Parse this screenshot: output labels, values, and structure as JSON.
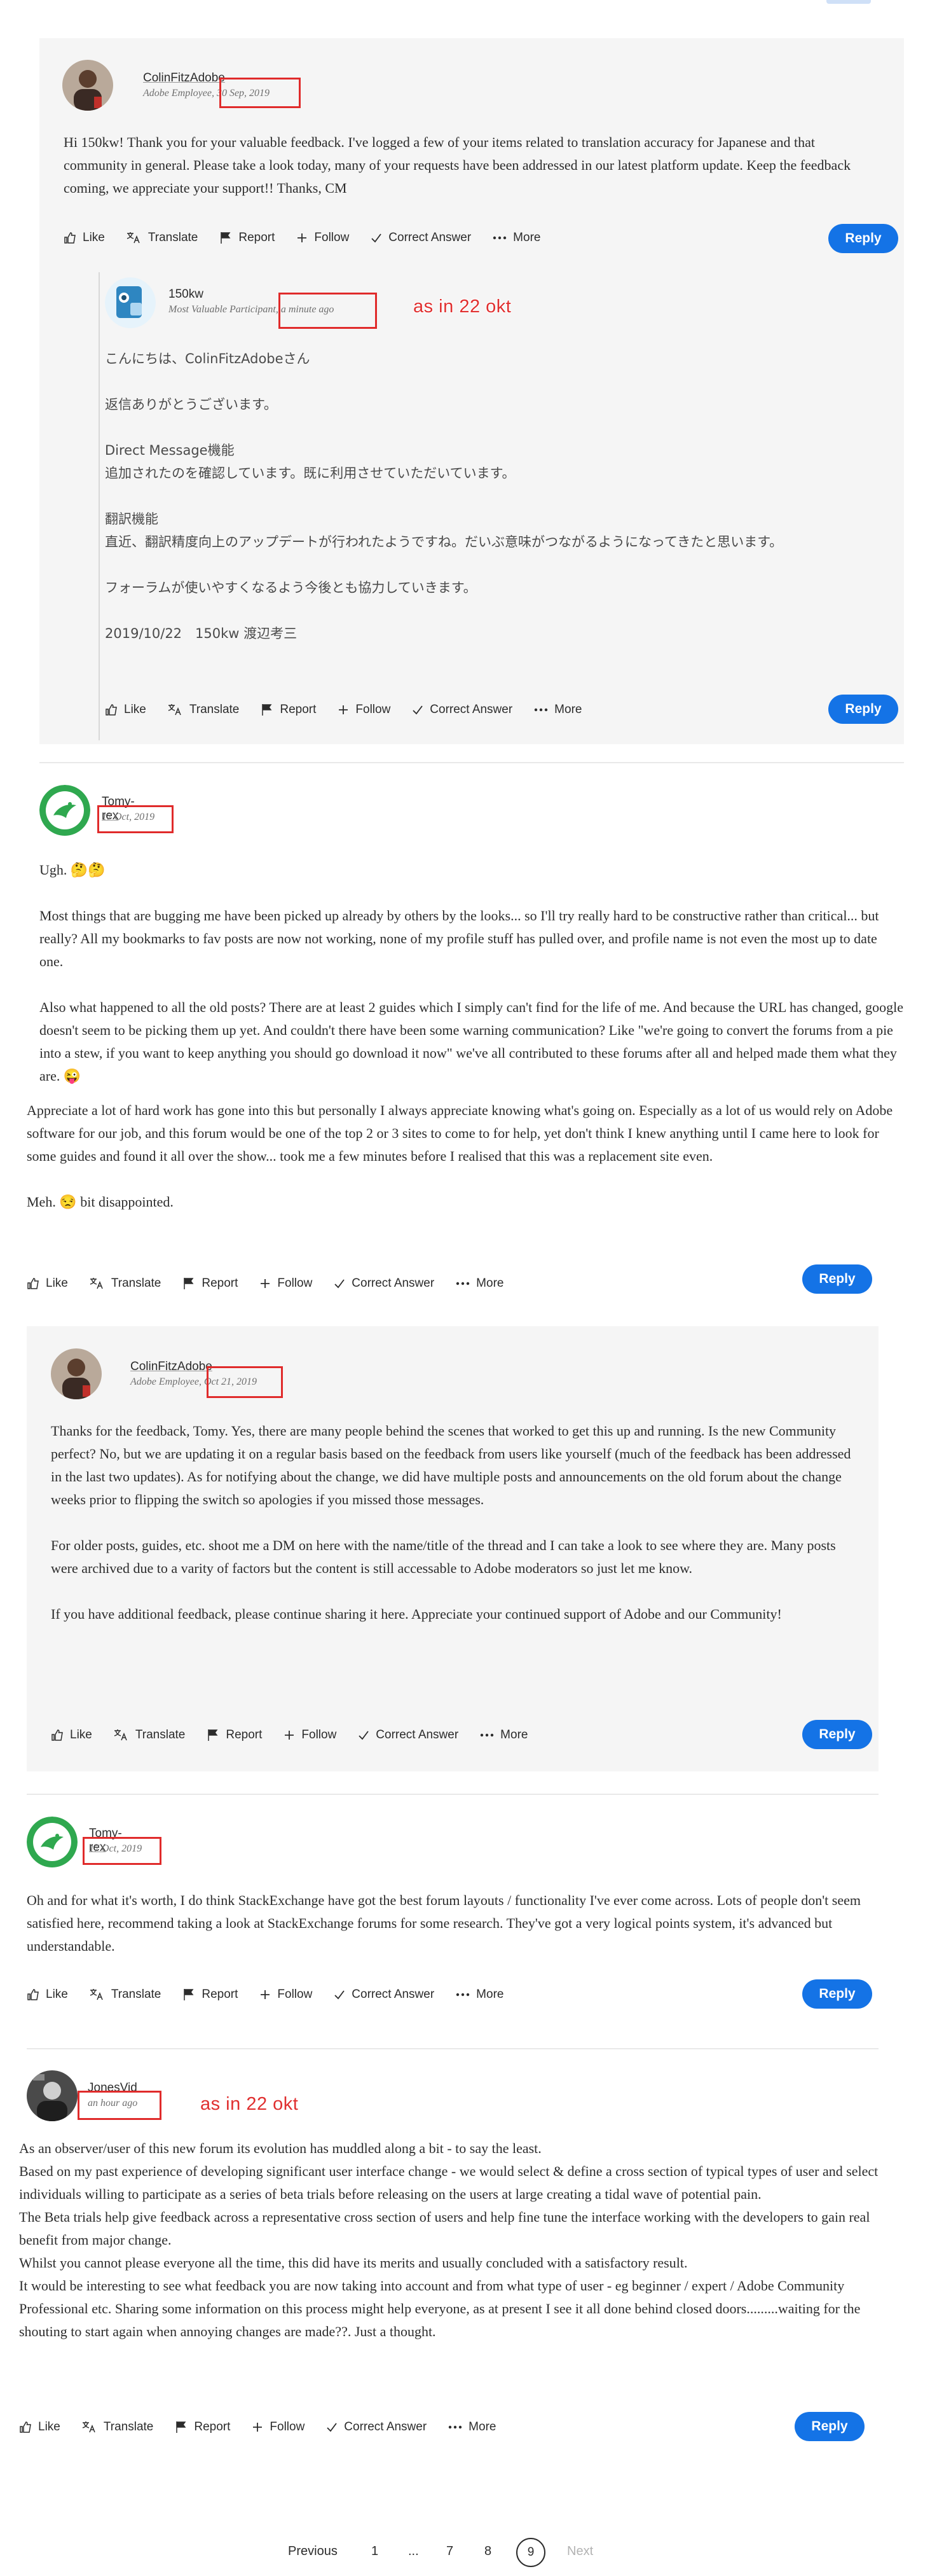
{
  "actions": {
    "like": "Like",
    "translate": "Translate",
    "report": "Report",
    "follow": "Follow",
    "correct": "Correct Answer",
    "more": "More",
    "reply": "Reply"
  },
  "posts": [
    {
      "author": "ColinFitzAdobe",
      "role": "Adobe Employee",
      "date": "30 Sep, 2019",
      "body": [
        "Hi 150kw! Thank you for your valuable feedback. I've logged a few of your items related to translation accuracy for Japanese and that community in general. Please take a look today, many of your requests have been addressed in our latest platform update. Keep the feedback coming, we appreciate your support!! Thanks, CM"
      ]
    },
    {
      "author": "150kw",
      "role": "Most Valuable Participant",
      "date": "a minute ago",
      "annotation": "as in 22 okt",
      "body": [
        "こんにちは、ColinFitzAdobeさん",
        "",
        "返信ありがとうございます。",
        "",
        "Direct Message機能",
        "追加されたのを確認しています。既に利用させていただいています。",
        "",
        "翻訳機能",
        "直近、翻訳精度向上のアップデートが行われたようですね。だいぶ意味がつながるようになってきたと思います。",
        "",
        "フォーラムが使いやすくなるよう今後とも協力していきます。",
        "",
        "2019/10/22　150kw 渡辺考三"
      ]
    },
    {
      "author": "Tomy-rex",
      "role": "",
      "date": "17 Oct, 2019",
      "body": [
        "Ugh. 🤔🤔",
        "",
        "Most things that are bugging me have been picked up already by others by the looks... so I'll try really hard to be constructive rather than critical... but really? All my bookmarks to fav posts are now not working, none of my profile stuff has pulled over, and profile name is not even the most up to date one.",
        "",
        "Also what happened to all the old posts? There are at least 2 guides which I simply can't find for the life of me. And because the URL has changed, google doesn't seem to be picking them up yet. And couldn't there have been some warning communication? Like \"we're going to convert the forums from a pie into a stew, if you want to keep anything you should go download it now\" we've all contributed to these forums after all and helped made them what they are. 😜",
        "",
        "Appreciate a lot of hard work has gone into this but personally I always appreciate knowing what's going on. Especially as a lot of us would rely on Adobe software for our job, and this forum would be one of the top 2 or 3 sites to come to for help, yet don't think I knew anything until I came here to look for some guides and found it all over the show... took me a few minutes before I realised that this was a replacement site even.",
        "",
        "Meh. 😒 bit disappointed."
      ]
    },
    {
      "author": "ColinFitzAdobe",
      "role": "Adobe Employee",
      "date": "Oct 21, 2019",
      "body": [
        "Thanks for the feedback, Tomy. Yes, there are many people behind the scenes that worked to get this up and running. Is the new Community perfect? No, but we are updating it on a regular basis based on the feedback from users like yourself (much of the feedback has been addressed in the last two updates). As for notifying about the change, we did have multiple posts and announcements on the old forum about the change weeks prior to flipping the switch so apologies if you missed those messages.",
        "",
        "For older posts, guides, etc. shoot me a DM on here with the name/title of the thread and I can take a look to see where they are. Many posts were archived due to a varity of factors but the content is still accessable to Adobe moderators so just let me know.",
        "",
        "If you have additional feedback, please continue sharing it here. Appreciate your continued support of Adobe and our Community!"
      ]
    },
    {
      "author": "Tomy-rex",
      "role": "",
      "date": "17 Oct, 2019",
      "body": [
        "Oh and for what it's worth, I do think StackExchange have got the best forum layouts / functionality I've ever come across. Lots of people don't seem satisfied here, recommend taking a look at StackExchange forums for some research. They've got a very logical points system, it's advanced but understandable."
      ]
    },
    {
      "author": "JonesVid",
      "role": "",
      "date": "an hour ago",
      "annotation": "as in 22 okt",
      "body": [
        "As an observer/user of this new forum its evolution has muddled along a bit - to say the least.",
        "Based on my past experience of developing significant user interface change - we would select & define a cross section of typical types of user and select individuals willing to participate as a series of beta trials before releasing on the users at large creating a tidal wave of potential pain.",
        "The Beta trials help give feedback across a representative cross section of users and help fine tune the interface working with the developers to gain real benefit from major change.",
        "Whilst you cannot please everyone all the time, this did have its merits and usually concluded with a satisfactory result.",
        "It would be interesting to see what feedback you are now taking into account and from what type of user - eg beginner / expert / Adobe Community Professional etc. Sharing some information on this process might help everyone, as at present I see it all done behind closed doors.........waiting for the shouting to start again when annoying changes are made??. Just a thought."
      ]
    }
  ],
  "pagination": {
    "previous": "Previous",
    "pages": [
      "1",
      "...",
      "7",
      "8"
    ],
    "current": "9",
    "next": "Next"
  },
  "colors": {
    "reply_button": "#1473e6",
    "annotation": "#e02b2b",
    "panel": "#f5f5f5"
  }
}
